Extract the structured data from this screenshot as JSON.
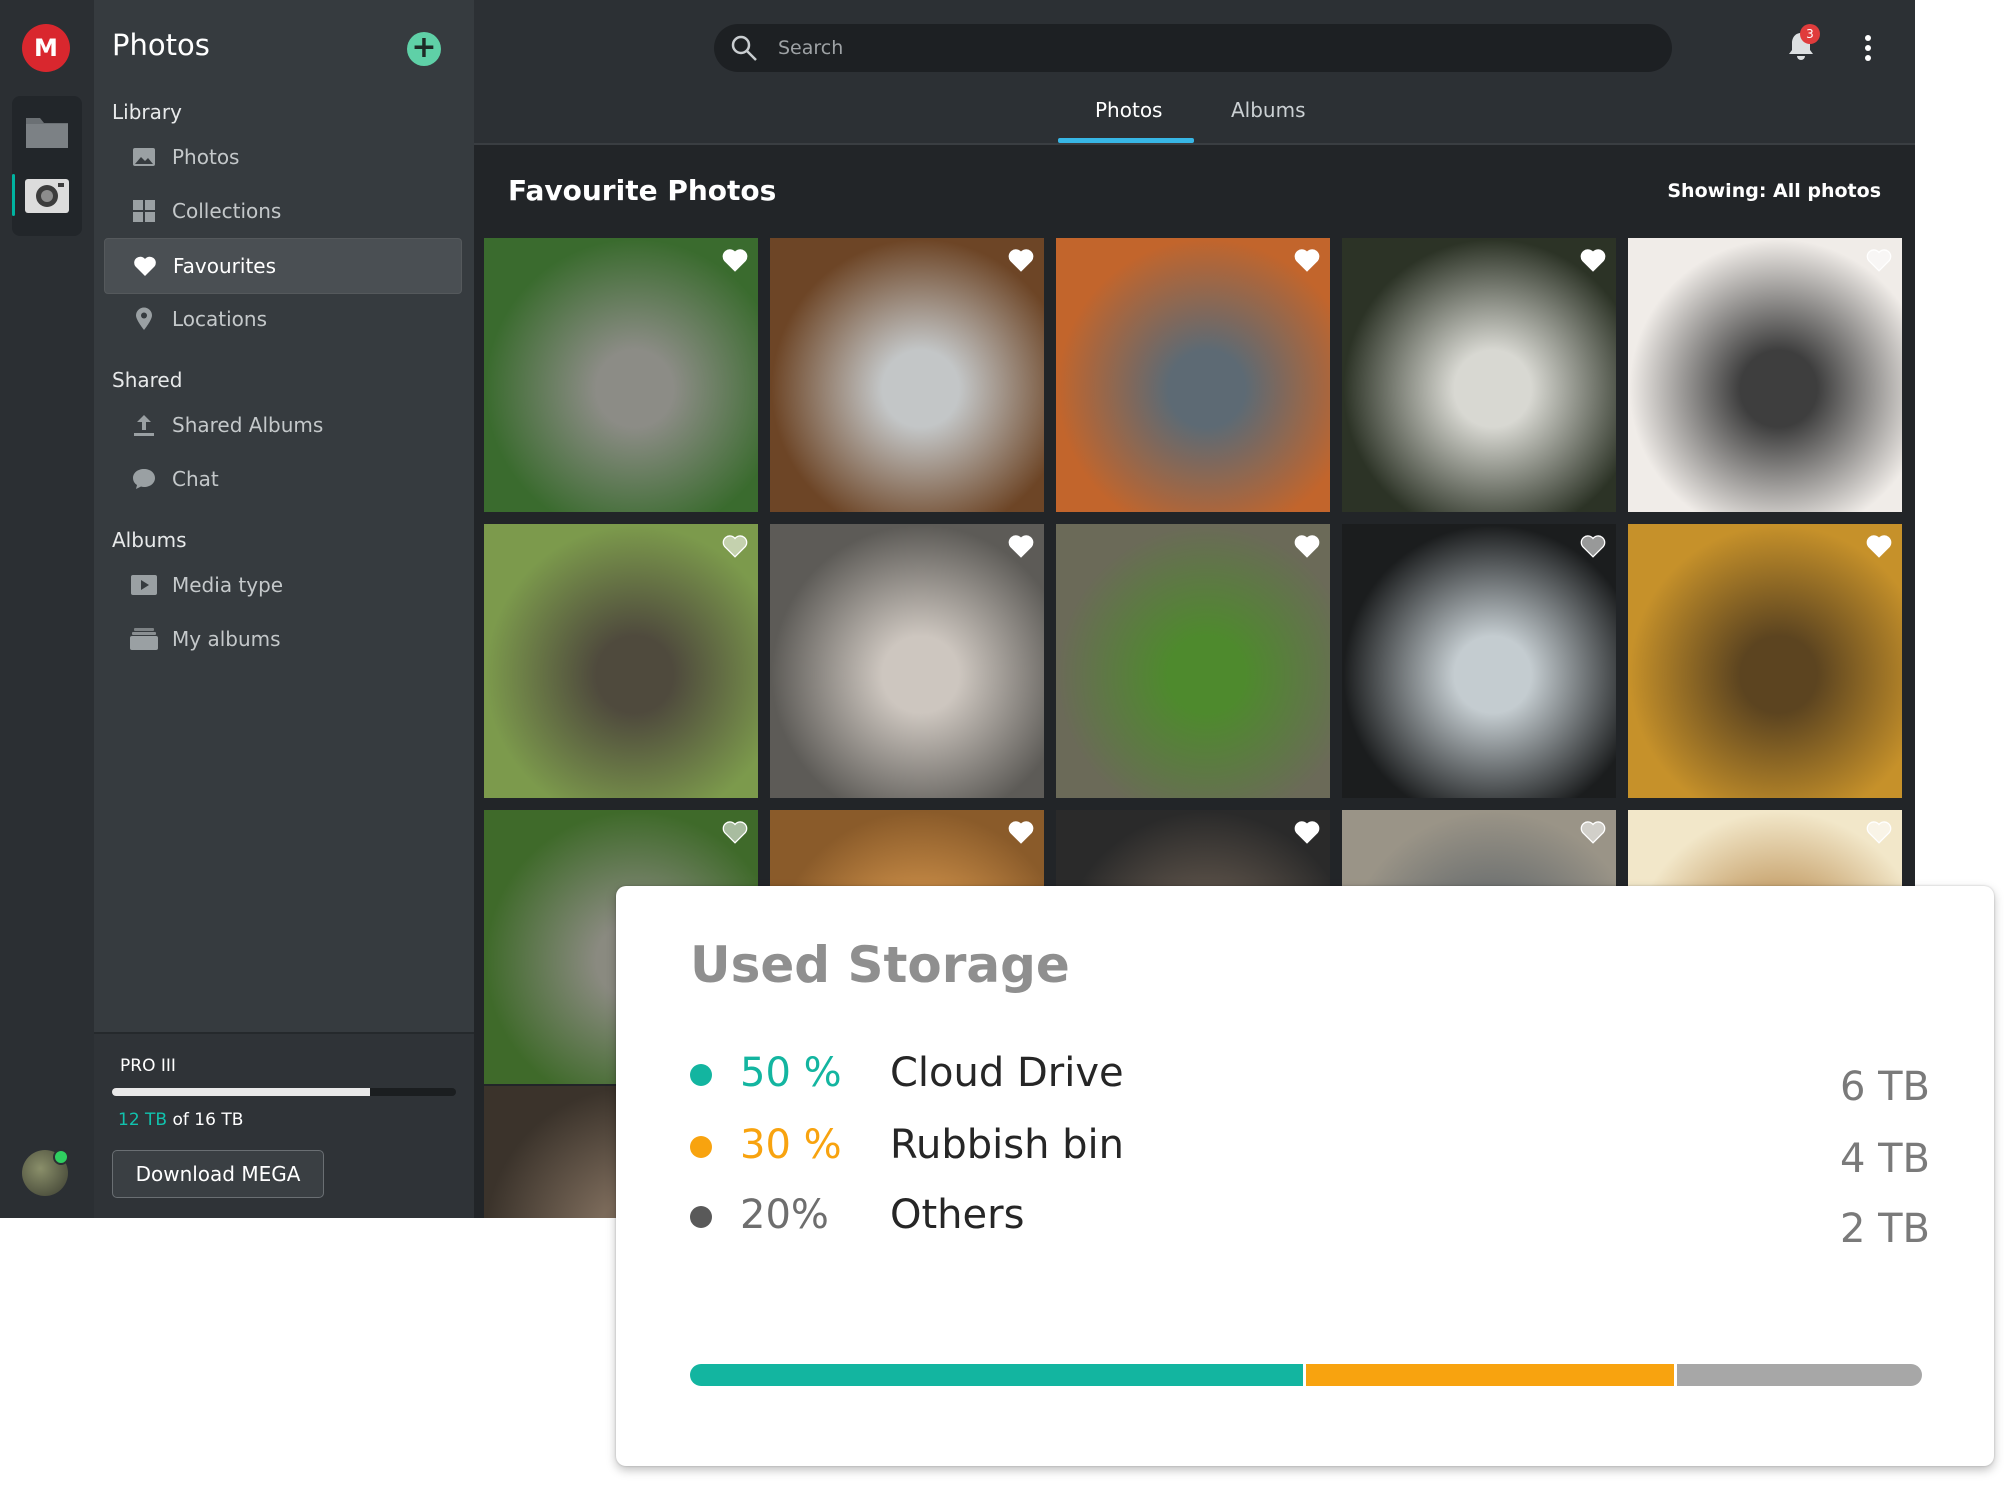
{
  "app": {
    "logo_letter": "M",
    "title": "Photos"
  },
  "sidebar": {
    "library_label": "Library",
    "library_items": [
      {
        "label": "Photos",
        "icon": "image-icon"
      },
      {
        "label": "Collections",
        "icon": "grid-icon"
      },
      {
        "label": "Favourites",
        "icon": "heart-icon",
        "active": true
      },
      {
        "label": "Locations",
        "icon": "location-pin-icon"
      }
    ],
    "shared_label": "Shared",
    "shared_items": [
      {
        "label": "Shared Albums",
        "icon": "upload-icon"
      },
      {
        "label": "Chat",
        "icon": "chat-bubble-icon"
      }
    ],
    "albums_label": "Albums",
    "album_items": [
      {
        "label": "Media type",
        "icon": "play-icon"
      },
      {
        "label": "My albums",
        "icon": "stack-icon"
      }
    ]
  },
  "plan": {
    "name": "PRO III",
    "used": "12 TB",
    "of_text": " of 16 TB",
    "used_fraction": 0.75,
    "download_label": "Download MEGA"
  },
  "header": {
    "search_placeholder": "Search",
    "notification_count": "3",
    "tabs": [
      "Photos",
      "Albums"
    ],
    "active_tab": 0
  },
  "content": {
    "title": "Favourite Photos",
    "showing": "Showing: All photos",
    "photos": [
      {
        "subject": "grey longhair cat in greenery",
        "tone": [
          "#3a6b2e",
          "#8c8c86"
        ],
        "favourite": true
      },
      {
        "subject": "orange tabby cat with blue collar",
        "tone": [
          "#6d4526",
          "#c3c6c7"
        ],
        "favourite": true
      },
      {
        "subject": "ginger cat lying on wooden deck",
        "tone": [
          "#c2652c",
          "#5d6a74"
        ],
        "favourite": true
      },
      {
        "subject": "white cat by window curtain",
        "tone": [
          "#2c3326",
          "#d8d8d2"
        ],
        "favourite": true
      },
      {
        "subject": "black and white cat yawning",
        "tone": [
          "#f0ece8",
          "#3e3e3e"
        ],
        "favourite": false
      },
      {
        "subject": "tabby cat in garden",
        "tone": [
          "#7c9a4c",
          "#4f4a3d"
        ],
        "favourite": false
      },
      {
        "subject": "white cat behind glass",
        "tone": [
          "#5d5b57",
          "#cdc6bf"
        ],
        "favourite": true
      },
      {
        "subject": "cat by potted plant",
        "tone": [
          "#6b6a58",
          "#4e8a2d"
        ],
        "favourite": true
      },
      {
        "subject": "black cat at window",
        "tone": [
          "#1b1d1e",
          "#c4ccd0"
        ],
        "favourite": false
      },
      {
        "subject": "grey cat in golden field",
        "tone": [
          "#c6912a",
          "#5c4420"
        ],
        "favourite": true
      },
      {
        "subject": "cat under leaves",
        "tone": [
          "#3f6a2a",
          "#8a8a80"
        ],
        "favourite": false
      },
      {
        "subject": "fluffy orange cat close-up",
        "tone": [
          "#8a5b2a",
          "#d9994e"
        ],
        "favourite": true
      },
      {
        "subject": "cat near dark furniture",
        "tone": [
          "#2a2a2a",
          "#6b5e52"
        ],
        "favourite": true
      },
      {
        "subject": "grey cat outdoors",
        "tone": [
          "#9a9487",
          "#5e6468"
        ],
        "favourite": false
      },
      {
        "subject": "cat in bright window",
        "tone": [
          "#f2e7c9",
          "#b7894c"
        ],
        "favourite": false
      },
      {
        "subject": "tabby cat portrait",
        "tone": [
          "#3b332b",
          "#7b6a5a"
        ],
        "favourite": false
      }
    ]
  },
  "storage": {
    "title": "Used Storage",
    "rows": [
      {
        "pct": "50 %",
        "label": "Cloud Drive",
        "size": "6 TB",
        "color": "#13b5a0",
        "value": 50
      },
      {
        "pct": "30 %",
        "label": "Rubbish bin",
        "size": "4 TB",
        "color": "#f8a30f",
        "value": 30
      },
      {
        "pct": "20%",
        "label": "Others",
        "size": "2 TB",
        "color": "#a7a7a7",
        "dot_color": "#595959",
        "pct_color": "#6e6e6e",
        "value": 20
      }
    ]
  }
}
